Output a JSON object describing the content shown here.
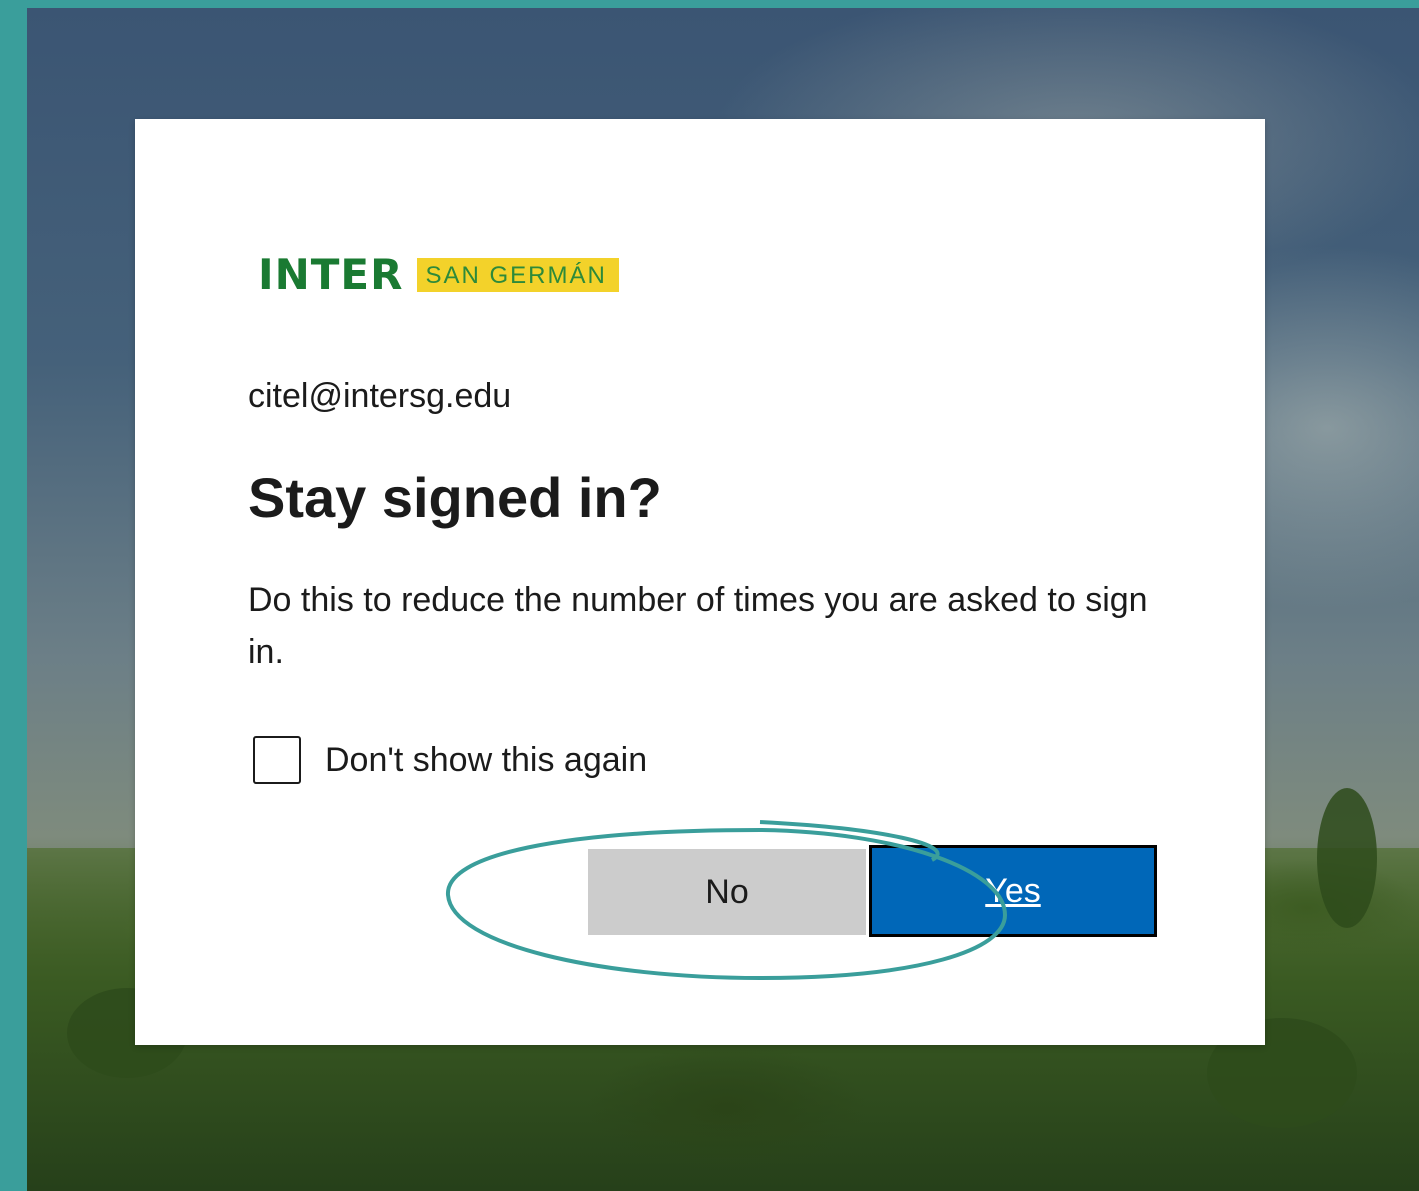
{
  "org_logo": {
    "brand": "INTER",
    "campus": "SAN GERMÁN"
  },
  "account": {
    "email": "citel@intersg.edu"
  },
  "prompt": {
    "title": "Stay signed in?",
    "description": "Do this to reduce the number of times you are asked to sign in."
  },
  "checkbox": {
    "label": "Don't show this again",
    "checked": false
  },
  "buttons": {
    "no_label": "No",
    "yes_label": "Yes"
  },
  "colors": {
    "frame": "#3a9e9b",
    "primary_button": "#0067b8",
    "secondary_button": "#cccccc",
    "annotation_stroke": "#3a9e9b",
    "logo_green": "#1a7a32",
    "logo_yellow": "#f3d22a"
  }
}
